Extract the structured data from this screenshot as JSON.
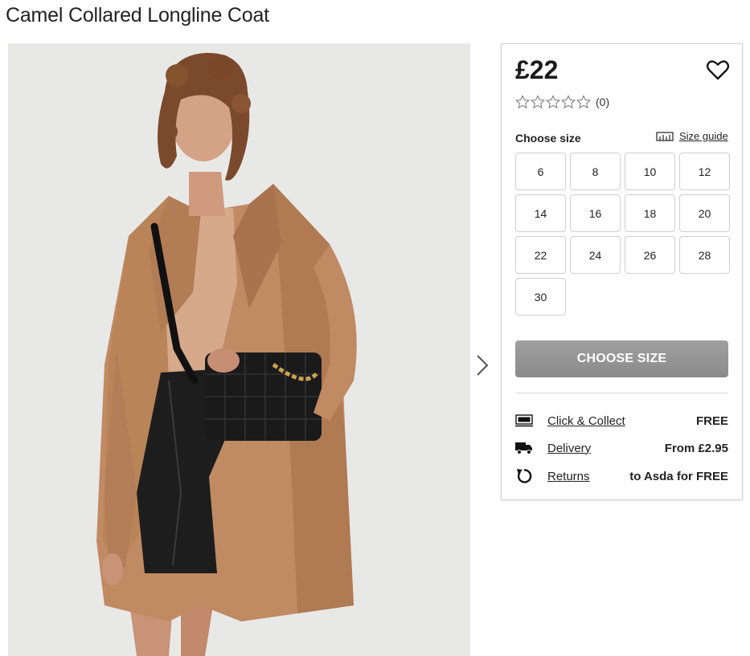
{
  "product": {
    "title": "Camel Collared Longline Coat",
    "price": "£22",
    "rating_count": "(0)",
    "stars_filled": 0,
    "stars_total": 5
  },
  "image": {
    "alt": "Model wearing camel collared longline coat with black quilted crossbody bag"
  },
  "size_selector": {
    "label": "Choose size",
    "guide_label": "Size guide",
    "sizes": [
      "6",
      "8",
      "10",
      "12",
      "14",
      "16",
      "18",
      "20",
      "22",
      "24",
      "26",
      "28",
      "30"
    ]
  },
  "cta": {
    "label": "CHOOSE SIZE"
  },
  "services": [
    {
      "icon": "click-collect-icon",
      "label": "Click & Collect",
      "value": "FREE"
    },
    {
      "icon": "delivery-truck-icon",
      "label": "Delivery",
      "value": "From £2.95"
    },
    {
      "icon": "returns-icon",
      "label": "Returns",
      "value": "to Asda for FREE"
    }
  ]
}
